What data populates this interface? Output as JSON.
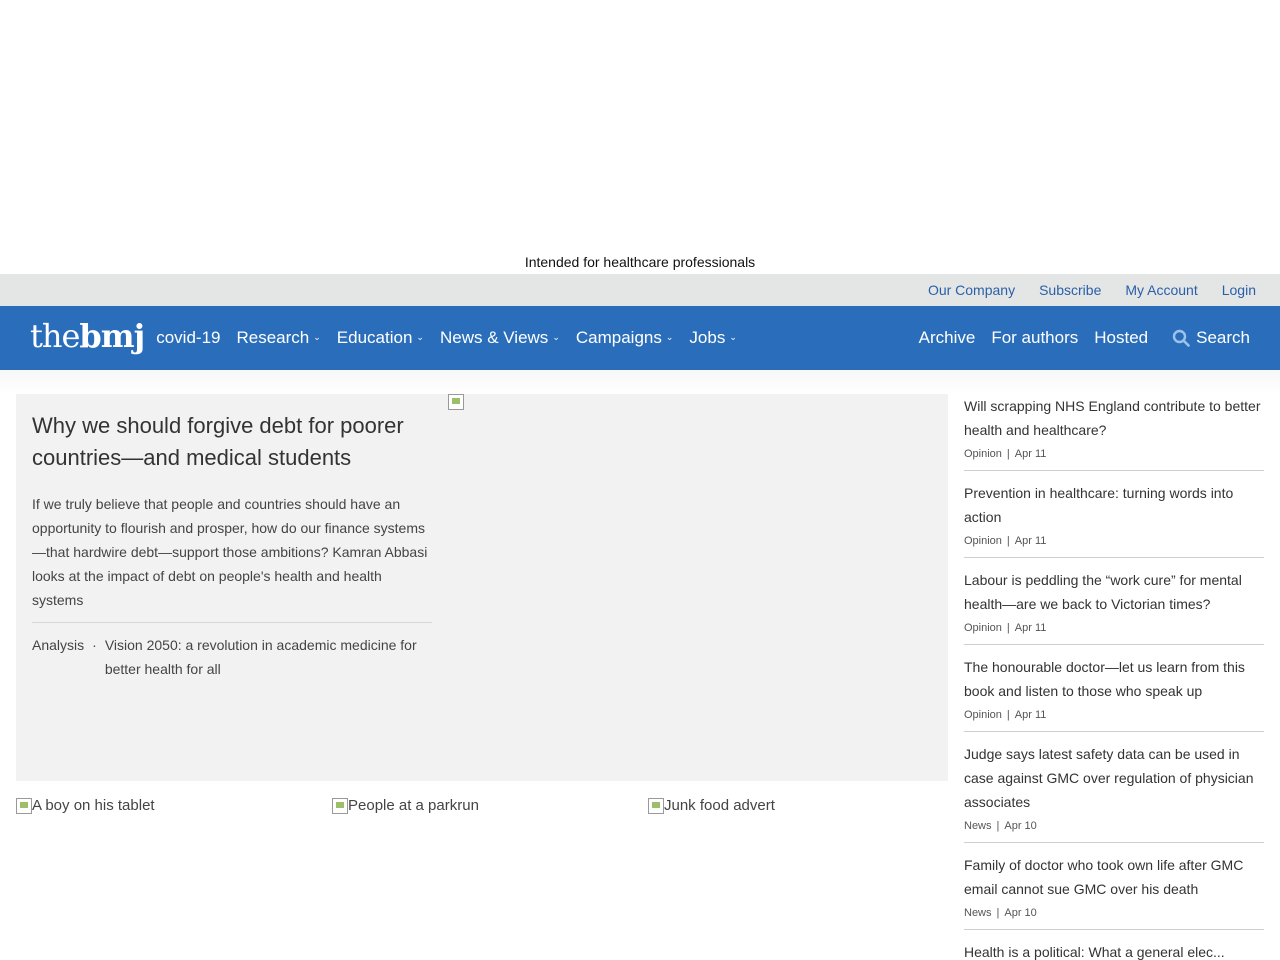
{
  "top": {
    "intended": "Intended for healthcare professionals"
  },
  "util": {
    "links": [
      "Our Company",
      "Subscribe",
      "My Account",
      "Login"
    ]
  },
  "nav": {
    "logo_the": "the",
    "logo_bmj": "bmj",
    "items": [
      "covid-19",
      "Research",
      "Education",
      "News & Views",
      "Campaigns",
      "Jobs"
    ],
    "right": [
      "Archive",
      "For authors",
      "Hosted"
    ],
    "search": "Search"
  },
  "feature": {
    "title": "Why we should forgive debt for poorer countries—and medical students",
    "body": "If we truly believe that people and countries should have an opportunity to flourish and prosper, how do our finance systems—that hardwire debt—support those ambitions? Kamran Abbasi looks at the impact of debt on people's health and health systems",
    "category": "Analysis",
    "dot": "·",
    "related": "Vision 2050: a revolution in academic medicine for better health for all"
  },
  "thumbs": [
    "A boy on his tablet",
    "People at a parkrun",
    "Junk food advert"
  ],
  "sidebar": [
    {
      "title": "Will scrapping NHS England contribute to better health and healthcare?",
      "type": "Opinion",
      "date": "Apr 11"
    },
    {
      "title": "Prevention in healthcare: turning words into action",
      "type": "Opinion",
      "date": "Apr 11"
    },
    {
      "title": "Labour is peddling the “work cure” for mental health—are we back to Victorian times?",
      "type": "Opinion",
      "date": "Apr 11"
    },
    {
      "title": "The honourable doctor—let us learn from this book and listen to those who speak up",
      "type": "Opinion",
      "date": "Apr 11"
    },
    {
      "title": "Judge says latest safety data can be used in case against GMC over regulation of physician associates",
      "type": "News",
      "date": "Apr 10"
    },
    {
      "title": "Family of doctor who took own life after GMC email cannot sue GMC over his death",
      "type": "News",
      "date": "Apr 10"
    },
    {
      "title": "Health is a political: What a general elec...",
      "type": "",
      "date": ""
    }
  ],
  "sep": "|"
}
